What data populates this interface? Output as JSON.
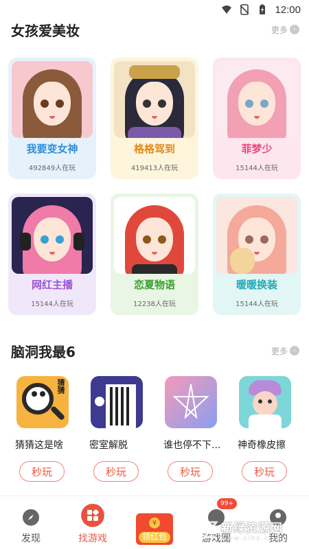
{
  "status": {
    "time": "12:00"
  },
  "section1": {
    "title": "女孩爱美妆",
    "more_label": "更多",
    "cards": [
      {
        "name": "我要变女神",
        "players": "492849人在玩",
        "name_color": "#2f8fd8",
        "bg": "#e6f2fb",
        "icon": "brown-hair-girl-icon"
      },
      {
        "name": "格格驾到",
        "players": "419413人在玩",
        "name_color": "#e08a1e",
        "bg": "#fdf5dc",
        "icon": "princess-qing-dynasty-icon"
      },
      {
        "name": "菲梦少",
        "players": "15144人在玩",
        "name_color": "#e5487a",
        "bg": "#fde6ee",
        "icon": "pink-hair-girl-icon"
      },
      {
        "name": "网红主播",
        "players": "15144人在玩",
        "name_color": "#9b54d2",
        "bg": "#f1e7fb",
        "icon": "headphones-girl-icon"
      },
      {
        "name": "恋夏物语",
        "players": "12238人在玩",
        "name_color": "#3a9e2f",
        "bg": "#e8f6e3",
        "icon": "red-hair-girl-icon"
      },
      {
        "name": "暖暖换装",
        "players": "15144人在玩",
        "name_color": "#21a9b4",
        "bg": "#e2f6f6",
        "icon": "girl-with-cat-icon"
      }
    ]
  },
  "section2": {
    "title": "脑洞我最6",
    "more_label": "更多",
    "play_label": "秒玩",
    "games": [
      {
        "name": "猜猜这是啥",
        "icon": "magnifier-panda-icon",
        "tag": "猜猜"
      },
      {
        "name": "密室解脱",
        "icon": "prison-door-icon"
      },
      {
        "name": "谁也停不下...",
        "icon": "star-line-icon"
      },
      {
        "name": "神奇橡皮擦",
        "icon": "towel-girl-icon"
      }
    ]
  },
  "tabs": [
    {
      "label": "发现",
      "icon": "compass-icon"
    },
    {
      "label": "找游戏",
      "icon": "game-grid-icon",
      "active": true
    },
    {
      "label": "领红包",
      "icon": "red-envelope-icon"
    },
    {
      "label": "游戏圈",
      "icon": "circle-icon",
      "badge": "99+"
    },
    {
      "label": "我的",
      "icon": "profile-icon"
    }
  ],
  "watermark": {
    "main": "新绿资源网",
    "sub": "www.xlhs.com"
  }
}
